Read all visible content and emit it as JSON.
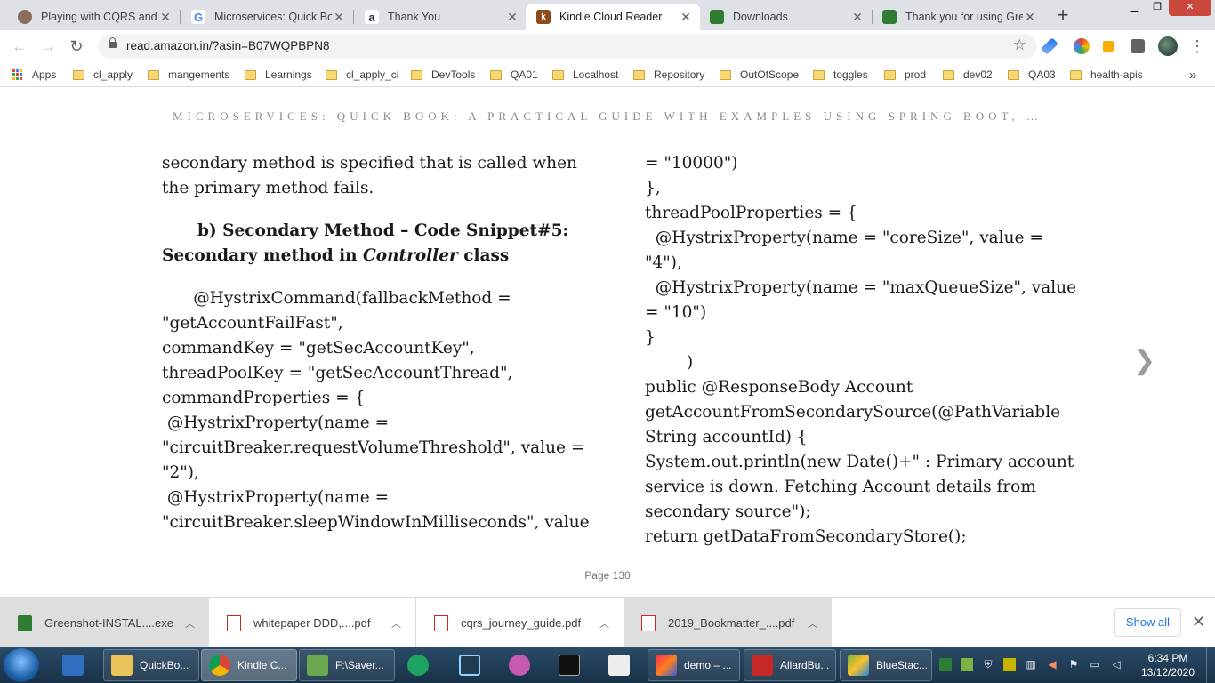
{
  "tabs": [
    {
      "title": "Playing with CQRS and E",
      "icon": "avatar-icon",
      "color": "#8a6d5a"
    },
    {
      "title": "Microservices: Quick Boo",
      "icon": "google-icon",
      "color": "#4285f4"
    },
    {
      "title": "Thank You",
      "icon": "amazon-icon",
      "color": "#232f3e"
    },
    {
      "title": "Kindle Cloud Reader",
      "icon": "kindle-icon",
      "color": "#8b4b1a"
    },
    {
      "title": "Downloads",
      "icon": "greenshot-icon",
      "color": "#2e7d32"
    },
    {
      "title": "Thank you for using Gree",
      "icon": "greenshot-icon",
      "color": "#2e7d32"
    }
  ],
  "browser": {
    "url": "read.amazon.in/?asin=B07WQPBPN8",
    "bookmarks": [
      "Apps",
      "cl_apply",
      "mangements",
      "Learnings",
      "cl_apply_ci",
      "DevTools",
      "QA01",
      "Localhost",
      "Repository",
      "OutOfScope",
      "toggles",
      "prod",
      "dev02",
      "QA03",
      "health-apis"
    ],
    "more": "»"
  },
  "reader": {
    "book_title": "MICROSERVICES: QUICK BOOK: A PRACTICAL GUIDE WITH EXAMPLES USING SPRING BOOT, …",
    "left": {
      "p1_l1": "secondary method is specified that is called when",
      "p1_l2": "the primary method fails.",
      "h_a": "b) Secondary Method – ",
      "h_link": "Code Snippet#5:",
      "h_b": "Secondary method in ",
      "h_em": "Controller",
      "h_c": " class",
      "code": [
        "      @HystrixCommand(fallbackMethod =",
        "\"getAccountFailFast\",",
        "commandKey = \"getSecAccountKey\",",
        "threadPoolKey = \"getSecAccountThread\",",
        "commandProperties = {",
        " @HystrixProperty(name =",
        "\"circuitBreaker.requestVolumeThreshold\", value =",
        "\"2\"),",
        " @HystrixProperty(name =",
        "\"circuitBreaker.sleepWindowInMilliseconds\", value"
      ]
    },
    "right": {
      "lines": [
        "= \"10000\")",
        "},",
        "threadPoolProperties = {",
        "  @HystrixProperty(name = \"coreSize\", value =",
        "\"4\"),",
        "  @HystrixProperty(name = \"maxQueueSize\", value",
        "= \"10\")",
        "}",
        "        )",
        "public @ResponseBody Account",
        "getAccountFromSecondarySource(@PathVariable",
        "String accountId) {",
        "System.out.println(new Date()+\" : Primary account",
        "service is down. Fetching Account details from",
        "secondary source\");",
        "return getDataFromSecondaryStore();"
      ]
    },
    "page_label": "Page 130",
    "next_icon": "chevron-right-icon"
  },
  "downloads": {
    "items": [
      {
        "name": "Greenshot-INSTAL....exe",
        "icon": "greenshot-icon"
      },
      {
        "name": "whitepaper DDD,....pdf",
        "icon": "pdf-icon"
      },
      {
        "name": "cqrs_journey_guide.pdf",
        "icon": "pdf-icon"
      },
      {
        "name": "2019_Bookmatter_....pdf",
        "icon": "pdf-icon"
      }
    ],
    "show_all": "Show all"
  },
  "taskbar": {
    "items": [
      {
        "label": "QuickBo...",
        "color": "#e8c35a"
      },
      {
        "label": "Kindle C...",
        "color": "#db4437"
      },
      {
        "label": "F:\\Saver...",
        "color": "#6aa84f"
      },
      {
        "label": "demo – ...",
        "color": "#c2185b"
      },
      {
        "label": "AllardBu...",
        "color": "#c62828"
      },
      {
        "label": "BlueStac...",
        "color": "#7cb342"
      }
    ],
    "time": "6:34 PM",
    "date": "13/12/2020"
  }
}
